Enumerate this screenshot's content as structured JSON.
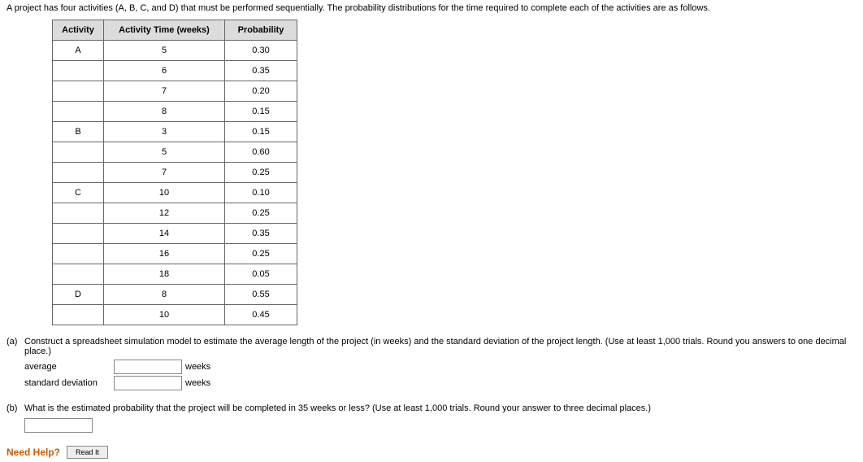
{
  "intro": "A project has four activities (A, B, C, and D) that must be performed sequentially. The probability distributions for the time required to complete each of the activities are as follows.",
  "table": {
    "headers": [
      "Activity",
      "Activity Time (weeks)",
      "Probability"
    ],
    "rows": [
      {
        "activity": "A",
        "time": "5",
        "prob": "0.30"
      },
      {
        "activity": "",
        "time": "6",
        "prob": "0.35"
      },
      {
        "activity": "",
        "time": "7",
        "prob": "0.20"
      },
      {
        "activity": "",
        "time": "8",
        "prob": "0.15"
      },
      {
        "activity": "B",
        "time": "3",
        "prob": "0.15"
      },
      {
        "activity": "",
        "time": "5",
        "prob": "0.60"
      },
      {
        "activity": "",
        "time": "7",
        "prob": "0.25"
      },
      {
        "activity": "C",
        "time": "10",
        "prob": "0.10"
      },
      {
        "activity": "",
        "time": "12",
        "prob": "0.25"
      },
      {
        "activity": "",
        "time": "14",
        "prob": "0.35"
      },
      {
        "activity": "",
        "time": "16",
        "prob": "0.25"
      },
      {
        "activity": "",
        "time": "18",
        "prob": "0.05"
      },
      {
        "activity": "D",
        "time": "8",
        "prob": "0.55"
      },
      {
        "activity": "",
        "time": "10",
        "prob": "0.45"
      }
    ]
  },
  "partA": {
    "label": "(a)",
    "text": "Construct a spreadsheet simulation model to estimate the average length of the project (in weeks) and the standard deviation of the project length. (Use at least 1,000 trials. Round you answers to one decimal place.)",
    "rows": [
      {
        "label": "average",
        "unit": "weeks"
      },
      {
        "label": "standard deviation",
        "unit": "weeks"
      }
    ]
  },
  "partB": {
    "label": "(b)",
    "text": "What is the estimated probability that the project will be completed in 35 weeks or less? (Use at least 1,000 trials. Round your answer to three decimal places.)"
  },
  "help": {
    "label": "Need Help?",
    "button": "Read It"
  }
}
